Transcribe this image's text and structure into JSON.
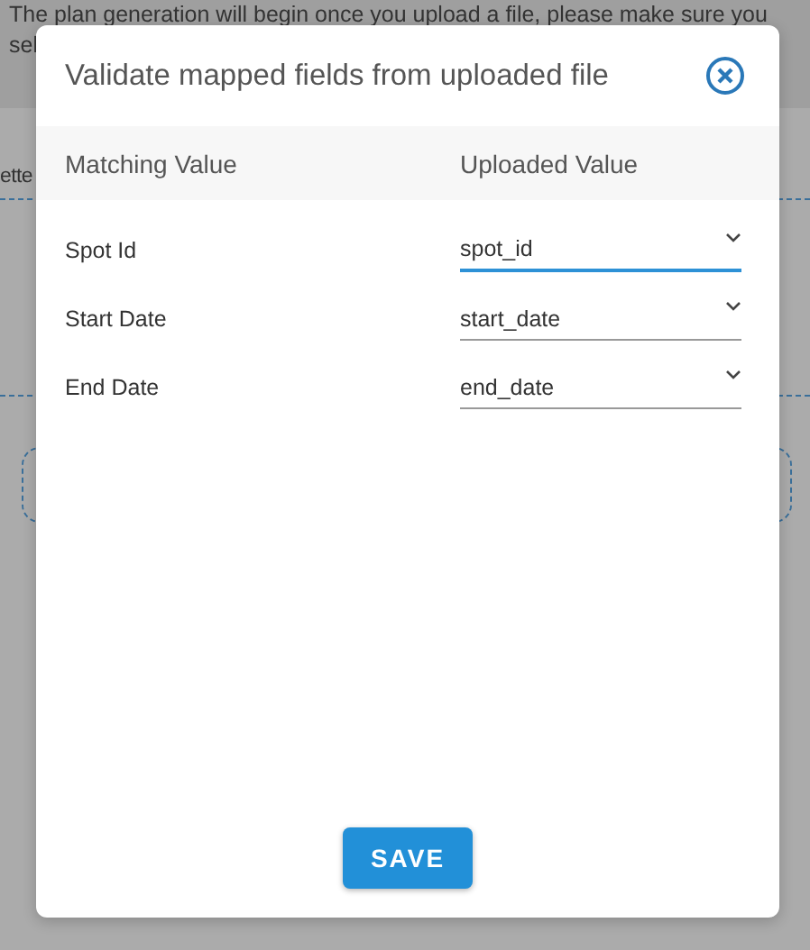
{
  "background": {
    "notice_lines": [
      "The plan generation will begin once you upload a file, please make sure you",
      "sel"
    ],
    "section_label": "ette"
  },
  "dialog": {
    "title": "Validate mapped fields from uploaded file",
    "columns": [
      "Matching Value",
      "Uploaded Value"
    ],
    "rows": [
      {
        "label": "Spot Id",
        "value": "spot_id",
        "focused": true
      },
      {
        "label": "Start Date",
        "value": "start_date",
        "focused": false
      },
      {
        "label": "End Date",
        "value": "end_date",
        "focused": false
      }
    ],
    "save_button": "SAVE"
  }
}
